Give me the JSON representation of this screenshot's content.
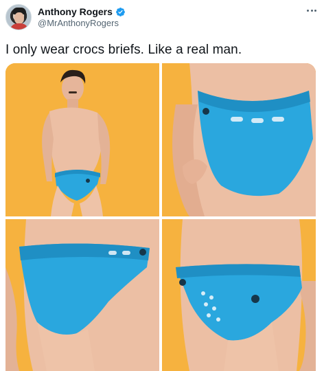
{
  "tweet": {
    "author": {
      "display_name": "Anthony Rogers",
      "handle": "@MrAnthonyRogers",
      "verified": true
    },
    "text": "I only wear crocs briefs. Like a real man.",
    "media": [
      {
        "label": "photo-1"
      },
      {
        "label": "photo-2"
      },
      {
        "label": "photo-3"
      },
      {
        "label": "photo-4"
      }
    ]
  },
  "icons": {
    "verified": "verified-badge-icon",
    "more": "more-options-icon"
  },
  "colors": {
    "verified_blue": "#1d9bf0",
    "background_orange": "#f6b23f",
    "briefs_blue": "#2aa7de",
    "secondary_text": "#536471"
  }
}
